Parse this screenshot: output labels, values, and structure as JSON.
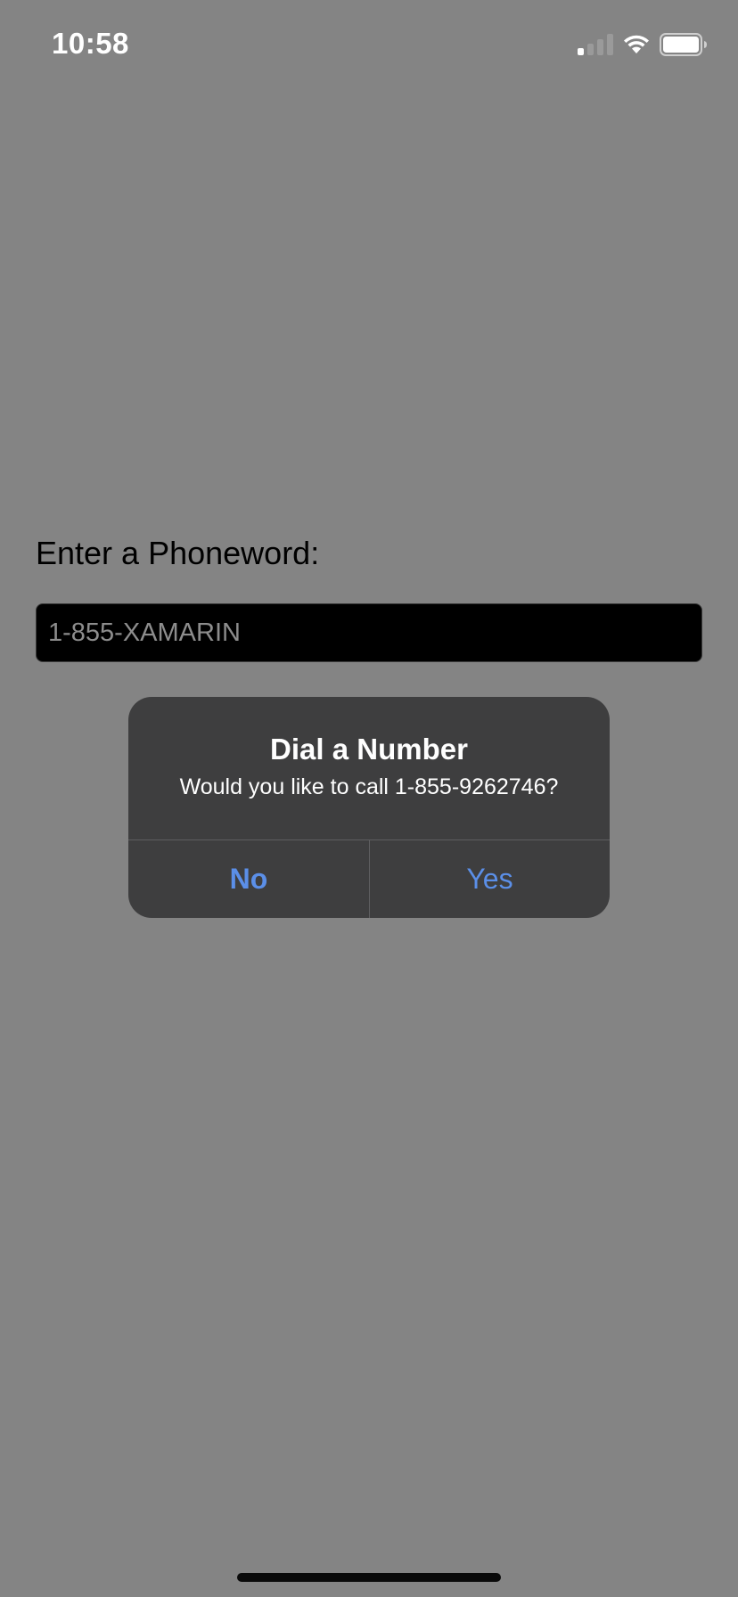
{
  "status_bar": {
    "time": "10:58",
    "signal_icon": "cellular-signal-icon",
    "wifi_icon": "wifi-icon",
    "battery_icon": "battery-icon",
    "signal_bars_active": 1,
    "signal_bars_total": 4
  },
  "main": {
    "prompt_label": "Enter a Phoneword:",
    "phone_input_value": "1-855-XAMARIN"
  },
  "alert": {
    "title": "Dial a Number",
    "message": "Would you like to call 1-855-9262746?",
    "no_label": "No",
    "yes_label": "Yes"
  },
  "colors": {
    "background": "#848484",
    "alert_background": "#3e3e3f",
    "button_accent": "#5b8fe8",
    "input_background": "#000000"
  }
}
